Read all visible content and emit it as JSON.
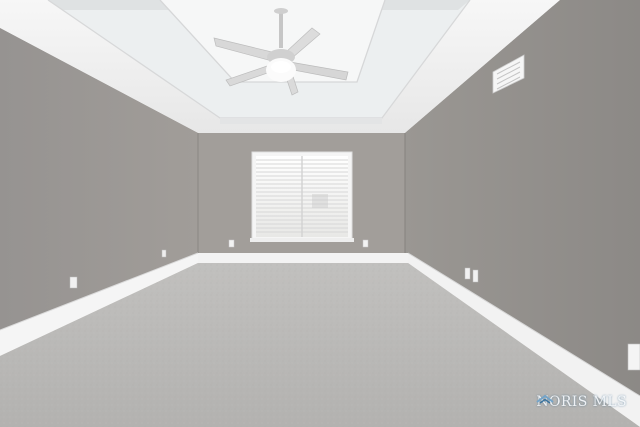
{
  "photo": {
    "scene": "empty-bedroom",
    "colors": {
      "ceiling": "#f1f1f1",
      "wall_left": "#979391",
      "wall_right": "#8f8c89",
      "wall_back": "#a19d99",
      "baseboard": "#f2f2f2",
      "carpet": "#b7b6b4",
      "window_blinds": "#f3f3f3"
    }
  },
  "watermark": {
    "text": "NORIS MLS",
    "icon": "house-icon",
    "color": "#2e6e9e"
  }
}
